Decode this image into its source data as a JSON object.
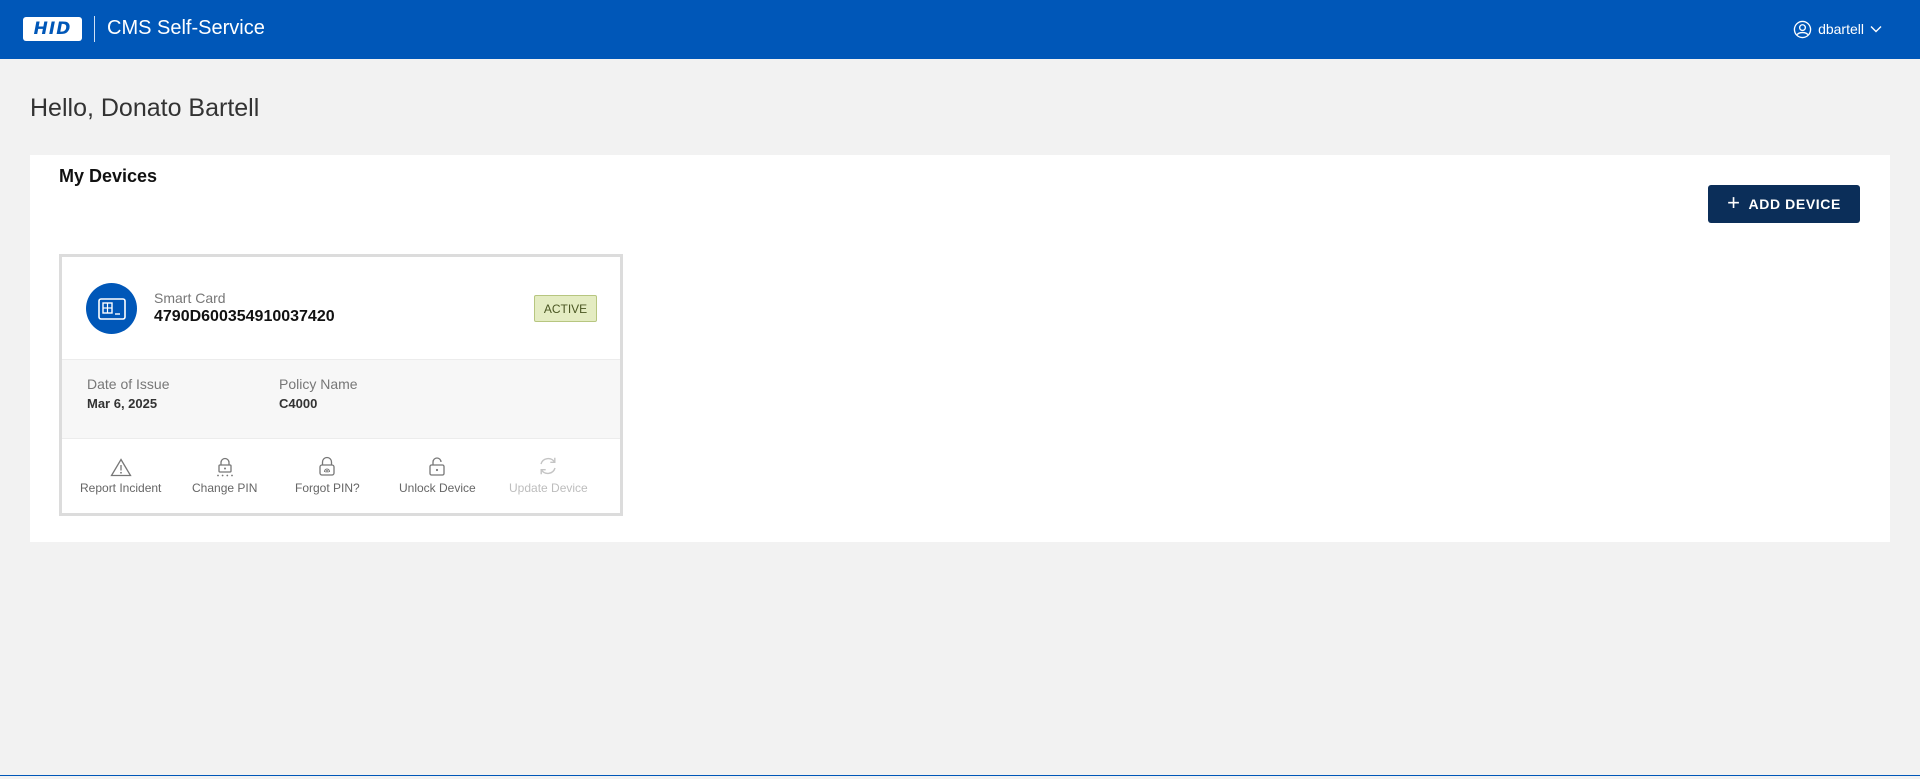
{
  "header": {
    "logo_text": "HID",
    "app_title": "CMS Self-Service",
    "username": "dbartell"
  },
  "greeting": "Hello, Donato Bartell",
  "devices_panel": {
    "title": "My Devices",
    "add_button_label": "ADD DEVICE"
  },
  "device": {
    "type": "Smart Card",
    "serial": "4790D600354910037420",
    "status": "ACTIVE",
    "date_of_issue_label": "Date of Issue",
    "date_of_issue": "Mar 6, 2025",
    "policy_name_label": "Policy Name",
    "policy_name": "C4000",
    "actions": {
      "report_incident": "Report Incident",
      "change_pin": "Change PIN",
      "forgot_pin": "Forgot PIN?",
      "unlock_device": "Unlock Device",
      "update_device": "Update Device"
    }
  },
  "colors": {
    "brand_blue": "#0057b8",
    "button_navy": "#0b2e59",
    "active_badge": "#e4ecc2"
  },
  "icons": {
    "user": "user-circle-icon",
    "chevron": "chevron-down-icon",
    "device": "smart-card-icon",
    "report": "warning-triangle-icon",
    "change_pin": "lock-pin-icon",
    "forgot_pin": "lock-fingerprint-icon",
    "unlock": "unlock-icon",
    "update": "refresh-icon"
  }
}
